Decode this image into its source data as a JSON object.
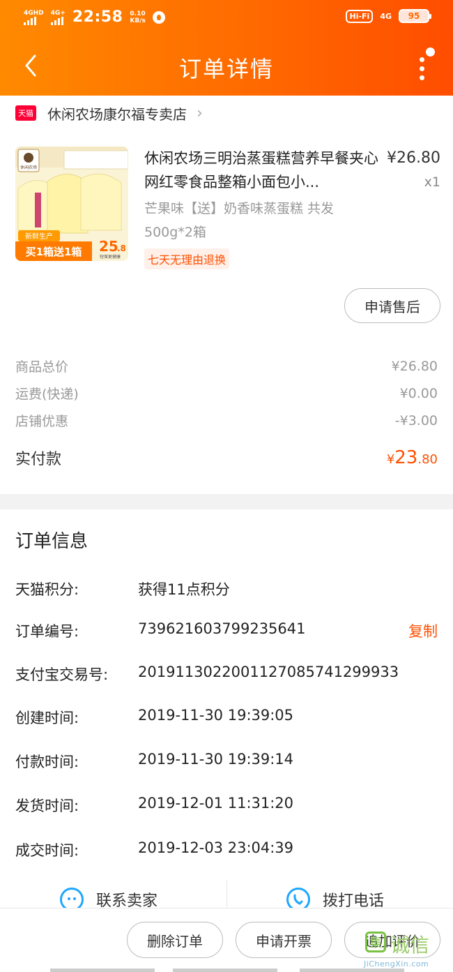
{
  "status_bar": {
    "sim1": "4GHD",
    "sim2": "4G+",
    "time": "22:58",
    "speed_value": "0.10",
    "speed_unit": "KB/s",
    "wifi_label": "Hi-Fi",
    "net_label": "4G",
    "battery": "95"
  },
  "header": {
    "title": "订单详情",
    "bg_color": "#ff6a00"
  },
  "store": {
    "badge": "天猫",
    "name": "休闲农场康尔福专卖店"
  },
  "product": {
    "name": "休闲农场三明治蒸蛋糕营养早餐夹心网红零食品整箱小面包小...",
    "price": "¥26.80",
    "qty": "x1",
    "spec": "芒果味【送】奶香味蒸蛋糕 共发500g*2箱",
    "tag": "七天无理由退换",
    "after_sale_label": "申请售后",
    "thumb": {
      "brand": "休闲农场",
      "fresh": "新鲜生产",
      "promo": "买1箱送1箱",
      "price_int": "25",
      "price_dec": ".8",
      "slogan": "短保更健康"
    }
  },
  "summary": {
    "rows": [
      {
        "label": "商品总价",
        "value": "¥26.80"
      },
      {
        "label": "运费(快递)",
        "value": "¥0.00"
      },
      {
        "label": "店铺优惠",
        "value": "-¥3.00"
      }
    ],
    "paid_label": "实付款",
    "paid_symbol": "¥",
    "paid_int": "23",
    "paid_dec": ".80",
    "accent": "#ff5000"
  },
  "order_info": {
    "title": "订单信息",
    "rows": [
      {
        "label": "天猫积分:",
        "value": "获得11点积分"
      },
      {
        "label": "订单编号:",
        "value": "739621603799235641",
        "action": "复制"
      },
      {
        "label": "支付宝交易号:",
        "value": "2019113022001127085741299933"
      },
      {
        "label": "创建时间:",
        "value": "2019-11-30 19:39:05"
      },
      {
        "label": "付款时间:",
        "value": "2019-11-30 19:39:14"
      },
      {
        "label": "发货时间:",
        "value": "2019-12-01 11:31:20"
      },
      {
        "label": "成交时间:",
        "value": "2019-12-03 23:04:39"
      }
    ]
  },
  "contact": {
    "seller_label": "联系卖家",
    "phone_label": "拨打电话"
  },
  "actions": {
    "delete_label": "删除订单",
    "invoice_label": "申请开票",
    "review_label": "追加评价"
  },
  "watermark": {
    "mark": "集",
    "text": "诚信",
    "url": "JiChengXin.com"
  }
}
